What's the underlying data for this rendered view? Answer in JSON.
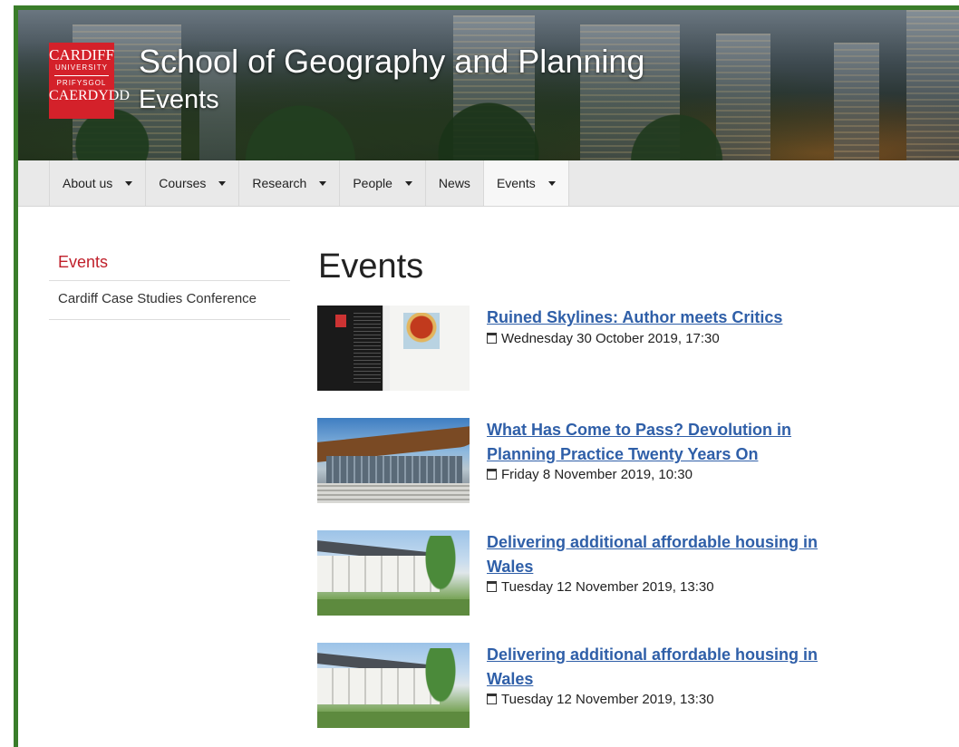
{
  "header": {
    "logo_lines": [
      "CARDIFF",
      "UNIVERSITY",
      "PRIFYSGOL",
      "CAERDYDD"
    ],
    "site_title": "School of Geography and Planning",
    "site_subtitle": "Events"
  },
  "nav": {
    "items": [
      {
        "label": "About us",
        "dropdown": true
      },
      {
        "label": "Courses",
        "dropdown": true
      },
      {
        "label": "Research",
        "dropdown": true
      },
      {
        "label": "People",
        "dropdown": true
      },
      {
        "label": "News",
        "dropdown": false
      },
      {
        "label": "Events",
        "dropdown": true,
        "active": true
      }
    ]
  },
  "sidebar": {
    "heading": "Events",
    "items": [
      {
        "label": "Cardiff Case Studies Conference"
      }
    ]
  },
  "main": {
    "title": "Events",
    "events": [
      {
        "title": "Ruined Skylines: Author meets Critics",
        "date": "Wednesday 30 October 2019, 17:30",
        "thumb": "book-cover"
      },
      {
        "title": "What Has Come to Pass? Devolution in Planning Practice Twenty Years On",
        "date": "Friday 8 November 2019, 10:30",
        "thumb": "senedd-building"
      },
      {
        "title": "Delivering additional affordable housing in Wales",
        "date": "Tuesday 12 November 2019, 13:30",
        "thumb": "terraced-houses"
      },
      {
        "title": "Delivering additional affordable housing in Wales",
        "date": "Tuesday 12 November 2019, 13:30",
        "thumb": "terraced-houses"
      }
    ]
  },
  "colors": {
    "frame": "#3a7d2a",
    "brand_red": "#d4212a",
    "link": "#2f5fa8",
    "sidebar_heading": "#c0202b"
  }
}
